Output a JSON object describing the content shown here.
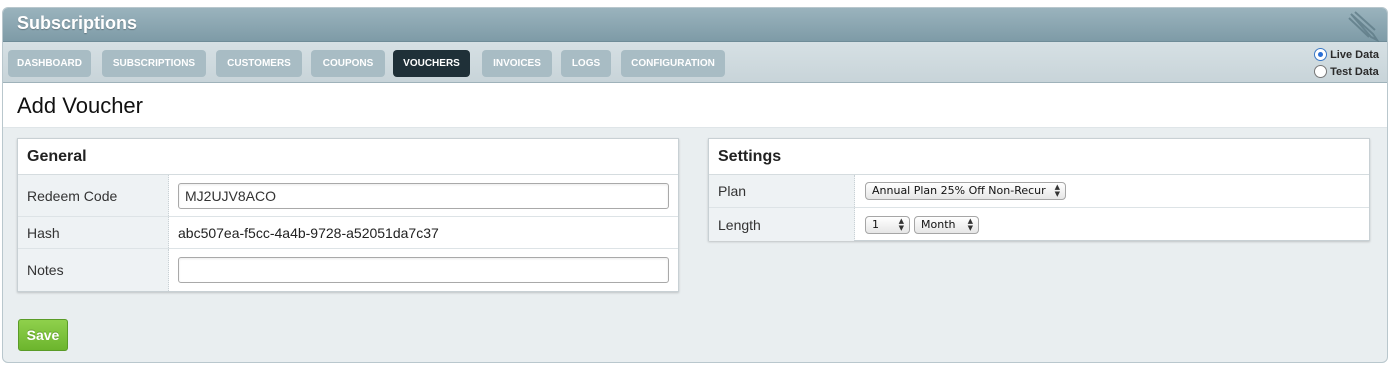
{
  "app": {
    "title": "Subscriptions"
  },
  "nav": {
    "tabs": [
      {
        "label": "DASHBOARD"
      },
      {
        "label": "SUBSCRIPTIONS"
      },
      {
        "label": "CUSTOMERS"
      },
      {
        "label": "COUPONS"
      },
      {
        "label": "VOUCHERS",
        "active": true
      },
      {
        "label": "INVOICES"
      },
      {
        "label": "LOGS"
      },
      {
        "label": "CONFIGURATION"
      }
    ]
  },
  "data_mode": {
    "options": [
      {
        "label": "Live Data",
        "checked": true
      },
      {
        "label": "Test Data",
        "checked": false
      }
    ]
  },
  "page": {
    "title": "Add Voucher"
  },
  "general": {
    "title": "General",
    "redeem_code_label": "Redeem Code",
    "redeem_code_value": "MJ2UJV8ACO",
    "hash_label": "Hash",
    "hash_value": "abc507ea-f5cc-4a4b-9728-a52051da7c37",
    "notes_label": "Notes",
    "notes_value": ""
  },
  "settings": {
    "title": "Settings",
    "plan_label": "Plan",
    "plan_value": "Annual Plan 25% Off Non-Recur",
    "length_label": "Length",
    "length_amount": "1",
    "length_unit": "Month"
  },
  "actions": {
    "save_label": "Save"
  },
  "colors": {
    "titlebar": "#8aa6b1",
    "nav_active": "#1f3038",
    "nav_tab": "#a8bcc4",
    "save_button": "#7cc13a"
  },
  "icons": {
    "brand": "pen-icon"
  }
}
